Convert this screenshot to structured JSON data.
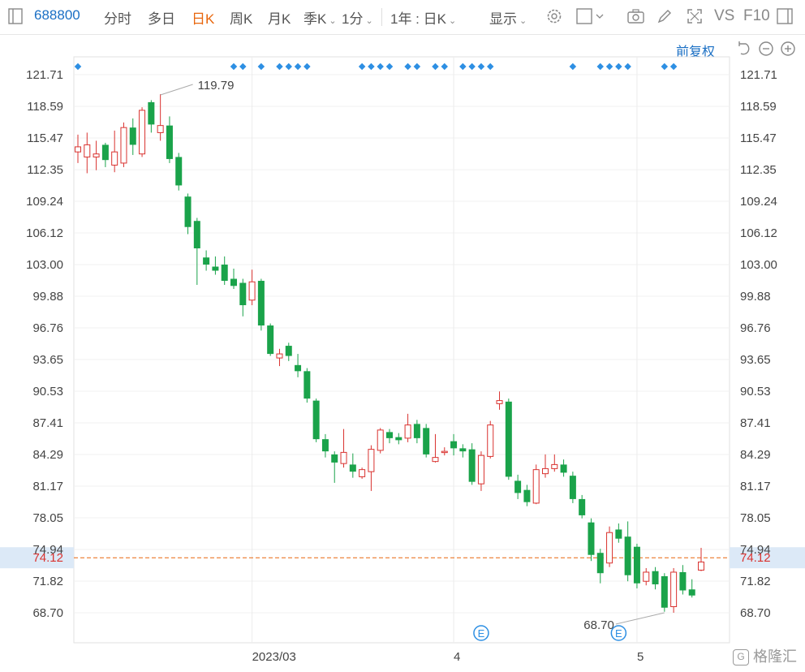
{
  "toolbar": {
    "code": "688800",
    "tabs": [
      "分时",
      "多日",
      "日K",
      "周K",
      "月K"
    ],
    "active_tab": "日K",
    "season": "季K",
    "minute": "1分",
    "range": "1年 : 日K",
    "display": "显示",
    "vs": "VS",
    "f10": "F10"
  },
  "subbar": {
    "adjust": "前复权"
  },
  "price_line": {
    "value": "74.12",
    "color": "#e8660d"
  },
  "watermark": "格隆汇",
  "colors": {
    "up": "#d9322f",
    "down": "#1aa34a",
    "dot": "#2d8fe3"
  },
  "chart_data": {
    "type": "candlestick",
    "ylim": [
      66.5,
      123.5
    ],
    "yticks": [
      121.71,
      118.59,
      115.47,
      112.35,
      109.24,
      106.12,
      103.0,
      99.88,
      96.76,
      93.65,
      90.53,
      87.41,
      84.29,
      81.17,
      78.05,
      74.94,
      71.82,
      68.7
    ],
    "ytick_labels": [
      "121.71",
      "118.59",
      "115.47",
      "112.35",
      "109.24",
      "106.12",
      "103.00",
      "99.88",
      "96.76",
      "93.65",
      "90.53",
      "87.41",
      "84.29",
      "81.17",
      "78.05",
      "74.94",
      "71.82",
      "68.70"
    ],
    "xtick_labels": [
      {
        "label": "2023/03",
        "index": 19
      },
      {
        "label": "4",
        "index": 41
      },
      {
        "label": "5",
        "index": 61
      }
    ],
    "annotations": [
      {
        "label": "119.79",
        "index": 9,
        "value": 119.79
      },
      {
        "label": "68.70",
        "index": 64,
        "value": 68.7
      }
    ],
    "event_markers": [
      {
        "label": "E",
        "index": 44
      },
      {
        "label": "E",
        "index": 59
      }
    ],
    "dot_indices": [
      0,
      17,
      18,
      20,
      22,
      23,
      24,
      25,
      31,
      32,
      33,
      34,
      36,
      37,
      39,
      40,
      42,
      43,
      44,
      45,
      54,
      57,
      58,
      59,
      60,
      64,
      65
    ],
    "ohlc": [
      [
        114.1,
        114.6,
        113.0,
        115.8
      ],
      [
        113.6,
        114.8,
        112.0,
        116.0
      ],
      [
        113.6,
        113.9,
        112.3,
        115.2
      ],
      [
        114.8,
        113.3,
        112.6,
        115.0
      ],
      [
        112.8,
        114.1,
        112.1,
        116.2
      ],
      [
        113.0,
        116.5,
        112.6,
        117.0
      ],
      [
        116.5,
        114.8,
        113.8,
        117.4
      ],
      [
        113.9,
        118.2,
        113.6,
        118.5
      ],
      [
        119.0,
        116.8,
        116.0,
        119.2
      ],
      [
        116.0,
        116.7,
        115.2,
        119.79
      ],
      [
        116.7,
        113.4,
        113.0,
        117.6
      ],
      [
        113.6,
        110.8,
        110.3,
        114.0
      ],
      [
        109.7,
        106.7,
        106.0,
        110.0
      ],
      [
        107.3,
        104.6,
        101.0,
        107.6
      ],
      [
        103.7,
        103.0,
        102.4,
        104.4
      ],
      [
        102.8,
        102.4,
        102.0,
        103.8
      ],
      [
        103.0,
        101.4,
        101.0,
        103.8
      ],
      [
        101.6,
        100.9,
        100.6,
        102.6
      ],
      [
        101.2,
        99.0,
        97.9,
        101.6
      ],
      [
        99.5,
        101.3,
        99.0,
        102.5
      ],
      [
        101.4,
        97.0,
        96.5,
        101.6
      ],
      [
        97.0,
        94.2,
        94.0,
        97.2
      ],
      [
        93.8,
        94.2,
        93.0,
        94.7
      ],
      [
        95.0,
        94.0,
        93.5,
        95.3
      ],
      [
        93.1,
        92.5,
        91.9,
        94.2
      ],
      [
        92.5,
        89.8,
        89.4,
        92.8
      ],
      [
        89.6,
        85.8,
        85.5,
        89.8
      ],
      [
        85.8,
        84.6,
        84.0,
        86.3
      ],
      [
        84.3,
        83.5,
        81.5,
        84.6
      ],
      [
        83.4,
        84.5,
        83.0,
        86.8
      ],
      [
        83.3,
        82.6,
        82.0,
        84.4
      ],
      [
        82.1,
        82.8,
        81.9,
        83.0
      ],
      [
        82.6,
        84.8,
        80.7,
        85.2
      ],
      [
        84.7,
        86.7,
        84.4,
        86.9
      ],
      [
        86.5,
        85.9,
        85.4,
        86.8
      ],
      [
        86.0,
        85.7,
        85.3,
        86.4
      ],
      [
        85.9,
        87.2,
        85.5,
        88.3
      ],
      [
        87.3,
        85.9,
        85.4,
        87.7
      ],
      [
        86.9,
        84.3,
        84.0,
        87.3
      ],
      [
        83.6,
        84.0,
        83.5,
        86.3
      ],
      [
        84.6,
        84.6,
        84.2,
        85.0
      ],
      [
        85.6,
        84.9,
        84.2,
        86.3
      ],
      [
        84.9,
        84.6,
        84.0,
        85.3
      ],
      [
        84.8,
        81.6,
        81.3,
        85.4
      ],
      [
        81.4,
        84.2,
        80.7,
        84.6
      ],
      [
        84.1,
        87.2,
        83.9,
        87.6
      ],
      [
        89.3,
        89.6,
        88.7,
        90.5
      ],
      [
        89.5,
        82.1,
        81.8,
        89.8
      ],
      [
        81.7,
        80.5,
        79.9,
        82.3
      ],
      [
        80.8,
        79.6,
        79.2,
        81.3
      ],
      [
        79.5,
        82.8,
        79.4,
        83.3
      ],
      [
        82.4,
        82.9,
        82.0,
        84.3
      ],
      [
        82.9,
        83.3,
        82.6,
        84.3
      ],
      [
        83.3,
        82.5,
        82.1,
        83.8
      ],
      [
        82.2,
        79.9,
        79.5,
        82.6
      ],
      [
        79.9,
        78.3,
        78.0,
        80.3
      ],
      [
        77.6,
        74.4,
        73.8,
        78.0
      ],
      [
        74.6,
        72.6,
        71.6,
        75.0
      ],
      [
        73.6,
        76.6,
        73.2,
        77.2
      ],
      [
        76.9,
        76.0,
        75.6,
        77.5
      ],
      [
        76.2,
        72.4,
        71.8,
        77.7
      ],
      [
        75.2,
        71.6,
        71.1,
        75.5
      ],
      [
        71.8,
        72.7,
        71.4,
        73.1
      ],
      [
        72.8,
        71.5,
        71.0,
        73.2
      ],
      [
        72.3,
        69.2,
        68.8,
        72.6
      ],
      [
        69.3,
        72.7,
        68.7,
        73.1
      ],
      [
        72.7,
        70.9,
        70.5,
        73.4
      ],
      [
        71.0,
        70.4,
        70.2,
        72.0
      ],
      [
        72.9,
        73.7,
        72.8,
        75.1
      ]
    ]
  }
}
